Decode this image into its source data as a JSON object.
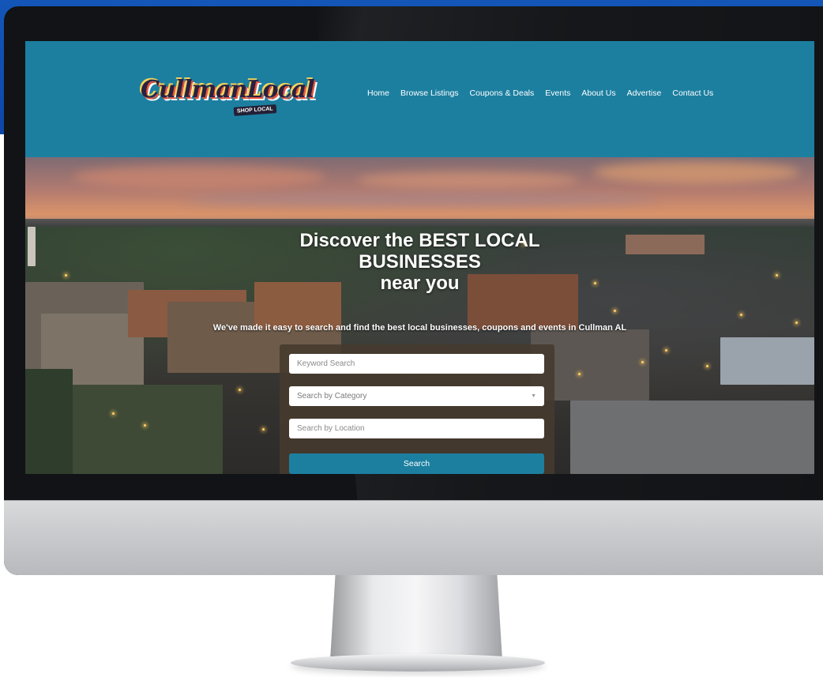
{
  "site": {
    "logo": {
      "main": "CullmanLocal",
      "tagline": "SHOP LOCAL"
    },
    "nav": [
      "Home",
      "Browse Listings",
      "Coupons & Deals",
      "Events",
      "About Us",
      "Advertise",
      "Contact Us"
    ],
    "hero": {
      "title_lines": [
        "Discover the BEST LOCAL",
        "BUSINESSES",
        "near you"
      ],
      "subtitle": "We've made it easy to search and find the best local businesses, coupons and events in Cullman AL"
    },
    "search": {
      "keyword_placeholder": "Keyword Search",
      "category_placeholder": "Search by Category",
      "location_placeholder": "Search by Location",
      "button_label": "Search"
    }
  },
  "colors": {
    "header": "#1c7fa0",
    "search_button": "#1c7fa0",
    "search_panel": "#463a2d",
    "background_corner": "#1356b8"
  }
}
